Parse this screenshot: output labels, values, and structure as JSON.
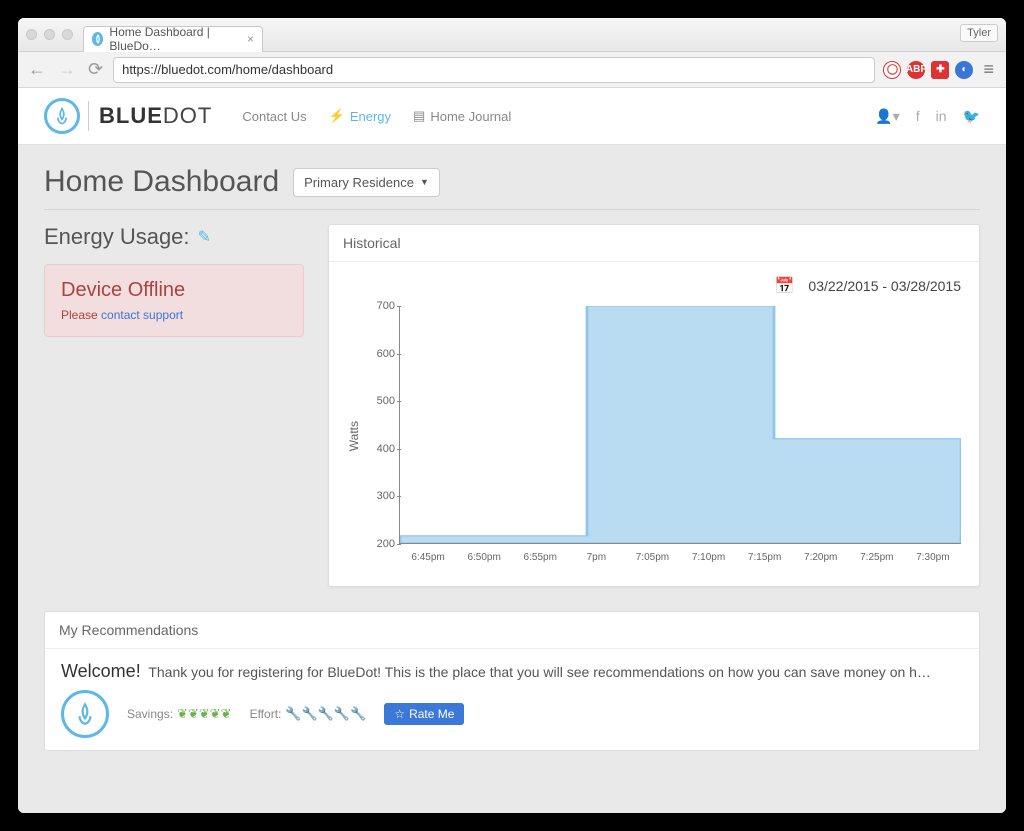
{
  "browser": {
    "tab_title": "Home Dashboard | BlueDo…",
    "url": "https://bluedot.com/home/dashboard",
    "user": "Tyler"
  },
  "brand": {
    "name_prefix": "BLUE",
    "name_suffix": "DOT"
  },
  "nav": {
    "contact": "Contact Us",
    "energy": "Energy",
    "journal": "Home Journal"
  },
  "page_title": "Home Dashboard",
  "residence_selector": "Primary Residence",
  "energy_section": {
    "heading": "Energy Usage:",
    "alert_title": "Device Offline",
    "alert_prefix": "Please ",
    "alert_link": "contact support"
  },
  "historical": {
    "title": "Historical",
    "date_range": "03/22/2015 - 03/28/2015"
  },
  "chart_data": {
    "type": "area",
    "ylabel": "Watts",
    "ylim": [
      200,
      700
    ],
    "yticks": [
      200,
      300,
      400,
      500,
      600,
      700
    ],
    "categories": [
      "6:45pm",
      "6:50pm",
      "6:55pm",
      "7pm",
      "7:05pm",
      "7:10pm",
      "7:15pm",
      "7:20pm",
      "7:25pm",
      "7:30pm"
    ],
    "values": [
      215,
      215,
      215,
      700,
      700,
      700,
      420,
      420,
      420,
      420
    ],
    "fill": "#b9dcf2",
    "stroke": "#8fc7ea"
  },
  "recommendations": {
    "title": "My Recommendations",
    "welcome_lead": "Welcome!",
    "welcome_text": "Thank you for registering for BlueDot! This is the place that you will see recommendations on how you can save money on h…",
    "savings_label": "Savings:",
    "savings_level": 5,
    "effort_label": "Effort:",
    "effort_level": 5,
    "rate_button": "Rate Me"
  }
}
